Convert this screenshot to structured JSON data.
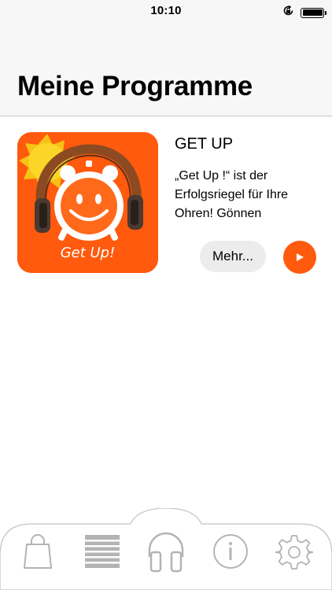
{
  "status_bar": {
    "time": "10:10",
    "icons": [
      "rotation-lock-icon",
      "battery-icon"
    ]
  },
  "header": {
    "title": "Meine Programme"
  },
  "programs": [
    {
      "title": "GET UP",
      "description": "„Get Up        !“ ist der Erfolgsriegel für Ihre Ohren! Gönnen",
      "image_text": "Get Up!",
      "more_label": "Mehr...",
      "play_icon": "play-icon"
    }
  ],
  "tab_bar": {
    "items": [
      {
        "name": "shop",
        "icon": "shopping-bag-icon"
      },
      {
        "name": "list",
        "icon": "list-icon"
      },
      {
        "name": "programs",
        "icon": "headphones-icon",
        "selected": true
      },
      {
        "name": "info",
        "icon": "info-icon"
      },
      {
        "name": "settings",
        "icon": "gear-icon"
      }
    ]
  },
  "colors": {
    "accent": "#ff5a0e",
    "header_bg": "#f7f7f7",
    "tab_icon": "#b3b3b3"
  }
}
